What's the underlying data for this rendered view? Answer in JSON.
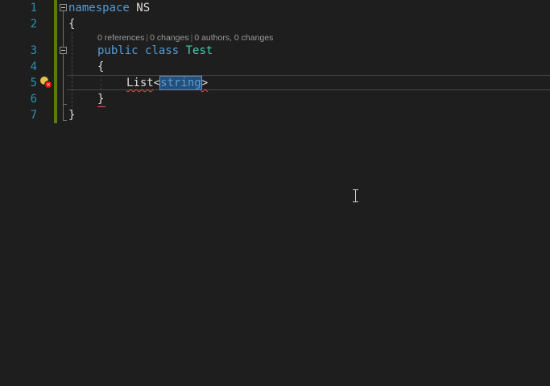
{
  "editor": {
    "line_numbers": [
      "1",
      "2",
      "3",
      "4",
      "5",
      "6",
      "7"
    ],
    "lines": {
      "l1_kw": "namespace",
      "l1_name": " NS",
      "l2": "{",
      "l3_kw1": "public",
      "l3_kw2": "class",
      "l3_type": "Test",
      "l4": "{",
      "l5_ident": "List",
      "l5_lt": "<",
      "l5_sel": "string",
      "l5_gt": ">",
      "l6": "}",
      "l7": "}"
    },
    "codelens": {
      "references": "0 references",
      "changes": "0 changes",
      "authors": "0 authors, 0 changes",
      "separator": "|"
    },
    "markers": {
      "lightbulb": "lightbulb-icon",
      "error": "error-icon",
      "error_glyph": "×"
    }
  },
  "colors": {
    "background": "#1e1e1e",
    "line_number": "#2b91af",
    "keyword": "#569cd6",
    "type": "#4ec9b0",
    "text": "#dcdcdc",
    "change_bar": "#587c0c",
    "selection": "#264f78",
    "error": "#e51400",
    "lightbulb": "#e8c04a"
  }
}
